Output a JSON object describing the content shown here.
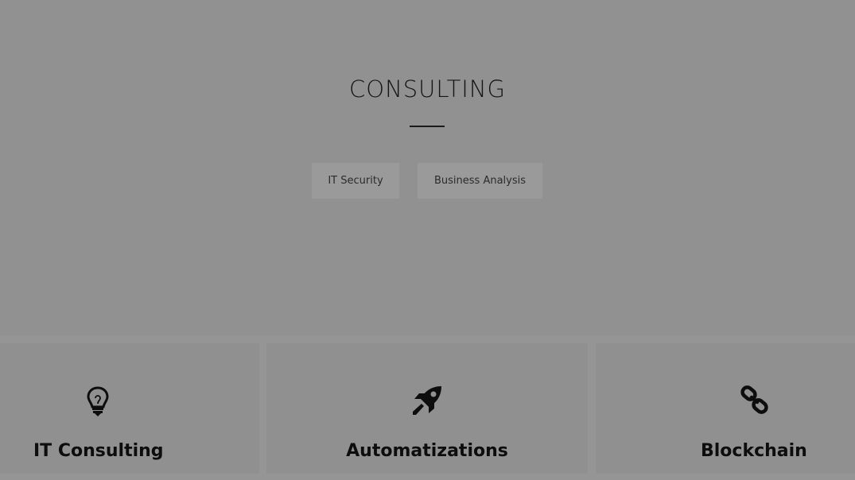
{
  "hero": {
    "title": "CONSULTING",
    "tags": [
      "IT Security",
      "Business Analysis"
    ]
  },
  "services": [
    {
      "title": "IT Consulting",
      "icon": "lightbulb-icon"
    },
    {
      "title": "Automatizations",
      "icon": "rocket-icon"
    },
    {
      "title": "Blockchain",
      "icon": "chain-link-icon"
    }
  ],
  "colors": {
    "overlay_gray": "#919191",
    "text_dark": "#151515",
    "chip_bg": "#9a9a9a"
  }
}
